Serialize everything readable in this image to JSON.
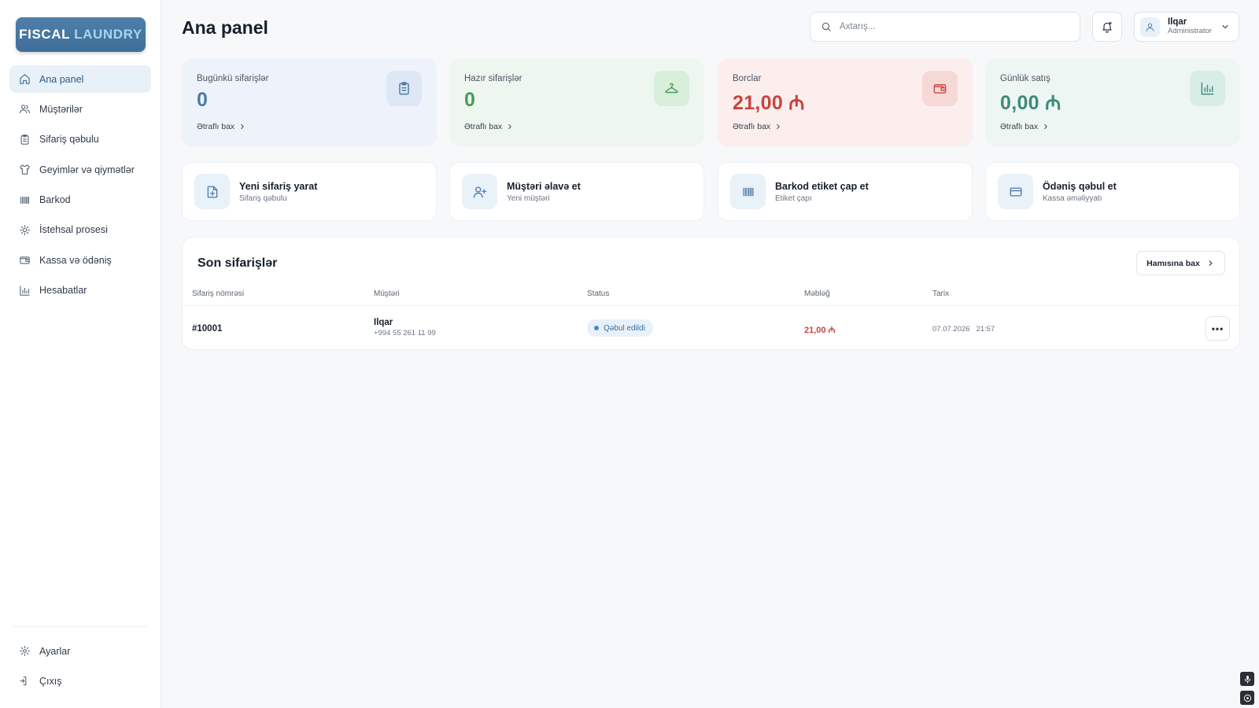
{
  "app": {
    "logo_part1": "FISCAL",
    "logo_part2": "LAUNDRY"
  },
  "sidebar": {
    "items": [
      {
        "label": "Ana panel",
        "icon": "home-icon",
        "active": true
      },
      {
        "label": "Müştərilər",
        "icon": "users-icon"
      },
      {
        "label": "Sifariş qəbulu",
        "icon": "clipboard-icon"
      },
      {
        "label": "Geyimlər və qiymətlər",
        "icon": "shirt-icon"
      },
      {
        "label": "Barkod",
        "icon": "barcode-icon"
      },
      {
        "label": "İstehsal prosesi",
        "icon": "sun-gear-icon"
      },
      {
        "label": "Kassa və ödəniş",
        "icon": "wallet-icon"
      },
      {
        "label": "Hesabatlar",
        "icon": "bar-chart-icon"
      }
    ],
    "bottom": [
      {
        "label": "Ayarlar",
        "icon": "settings-icon"
      },
      {
        "label": "Çıxış",
        "icon": "logout-icon"
      }
    ]
  },
  "header": {
    "title": "Ana panel",
    "search_placeholder": "Axtarış...",
    "user_name": "Ilqar",
    "user_role": "Administrator"
  },
  "stats": [
    {
      "label": "Bugünkü sifarişlər",
      "value": "0",
      "more": "Ətraflı bax",
      "icon": "clipboard-icon",
      "color": "#4d7aa5"
    },
    {
      "label": "Hazır sifarişlər",
      "value": "0",
      "more": "Ətraflı bax",
      "icon": "hanger-icon",
      "color": "#4a9a5a"
    },
    {
      "label": "Borclar",
      "value": "21,00 ₼",
      "more": "Ətraflı bax",
      "icon": "wallet-icon",
      "color": "#c8443e"
    },
    {
      "label": "Günlük satış",
      "value": "0,00 ₼",
      "more": "Ətraflı bax",
      "icon": "bar-chart-icon",
      "color": "#3f8a78"
    }
  ],
  "actions": [
    {
      "title": "Yeni sifariş yarat",
      "subtitle": "Sifariş qəbulu",
      "icon": "file-plus-icon"
    },
    {
      "title": "Müştəri əlavə et",
      "subtitle": "Yeni müştəri",
      "icon": "user-plus-icon"
    },
    {
      "title": "Barkod etiket çap et",
      "subtitle": "Etiket çapı",
      "icon": "barcode-icon"
    },
    {
      "title": "Ödəniş qəbul et",
      "subtitle": "Kassa əməliyyatı",
      "icon": "credit-card-icon"
    }
  ],
  "recent_orders": {
    "title": "Son sifarişlər",
    "see_all": "Hamısına bax",
    "columns": [
      "Sifariş nömrəsi",
      "Müştəri",
      "Status",
      "Məbləğ",
      "Tarix"
    ],
    "rows": [
      {
        "order_no": "#10001",
        "customer_name": "Ilqar",
        "customer_phone": "+994 55 261 11 99",
        "status": "Qəbul edildi",
        "amount": "21,00 ₼",
        "date": "07.07.2026",
        "time": "21:57",
        "more": "•••"
      }
    ]
  },
  "colors": {
    "accent": "#4d7aa5",
    "success": "#4a9a5a",
    "danger": "#c8443e",
    "teal": "#3f8a78"
  }
}
